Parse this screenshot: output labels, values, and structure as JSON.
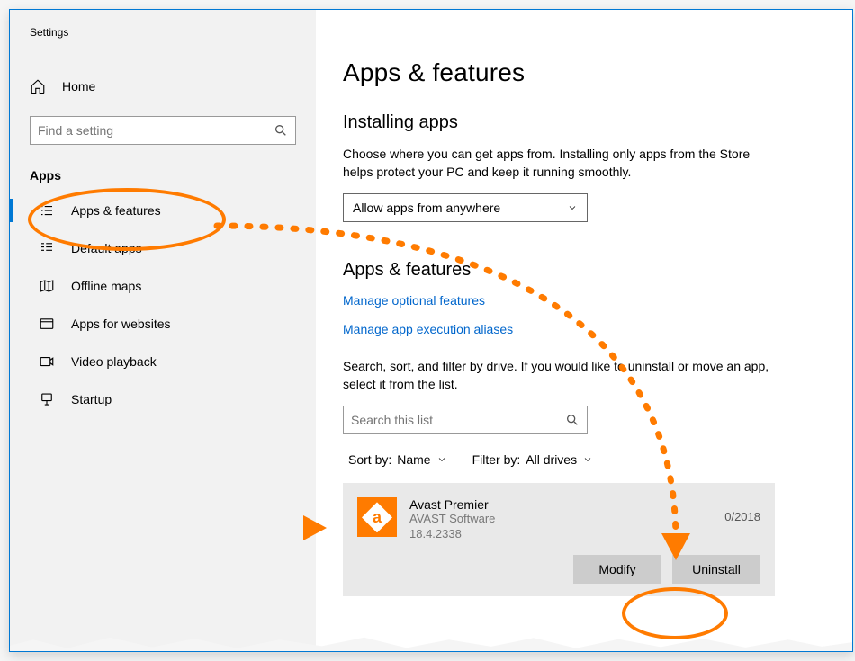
{
  "window": {
    "title": "Settings"
  },
  "sidebar": {
    "home": "Home",
    "search_placeholder": "Find a setting",
    "section": "Apps",
    "items": [
      {
        "label": "Apps & features"
      },
      {
        "label": "Default apps"
      },
      {
        "label": "Offline maps"
      },
      {
        "label": "Apps for websites"
      },
      {
        "label": "Video playback"
      },
      {
        "label": "Startup"
      }
    ]
  },
  "main": {
    "title": "Apps & features",
    "installing": {
      "heading": "Installing apps",
      "description": "Choose where you can get apps from. Installing only apps from the Store helps protect your PC and keep it running smoothly.",
      "select_value": "Allow apps from anywhere"
    },
    "apps_features": {
      "heading": "Apps & features",
      "link_optional": "Manage optional features",
      "link_aliases": "Manage app execution aliases",
      "search_desc": "Search, sort, and filter by drive. If you would like to uninstall or move an app, select it from the list.",
      "search_placeholder": "Search this list",
      "sort_label": "Sort by:",
      "sort_value": "Name",
      "filter_label": "Filter by:",
      "filter_value": "All drives"
    },
    "app": {
      "name": "Avast Premier",
      "vendor": "AVAST Software",
      "version": "18.4.2338",
      "date": "0/2018",
      "modify": "Modify",
      "uninstall": "Uninstall"
    }
  },
  "annotation_color": "#ff7b00"
}
